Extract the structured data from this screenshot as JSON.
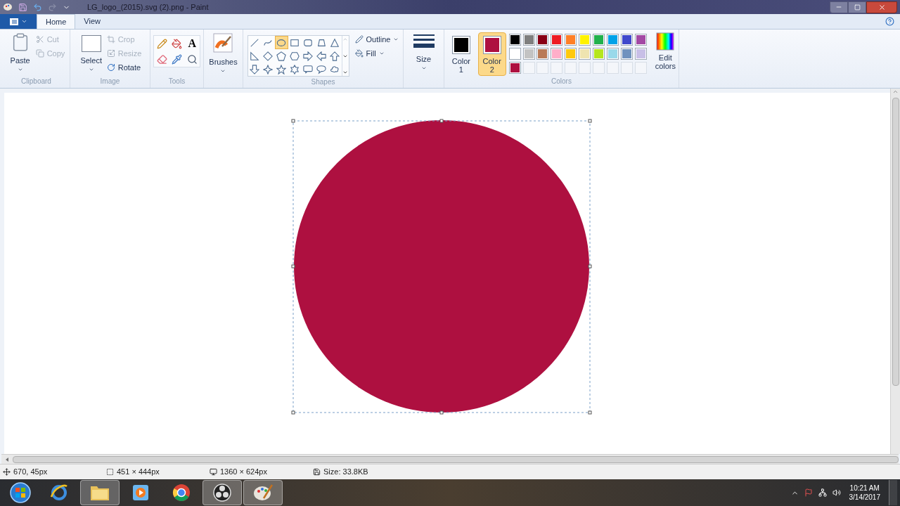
{
  "window": {
    "title": "LG_logo_(2015).svg (2).png - Paint"
  },
  "file_menu": {
    "open": false
  },
  "tabs": [
    {
      "label": "Home",
      "selected": true
    },
    {
      "label": "View",
      "selected": false
    }
  ],
  "clipboard": {
    "label": "Clipboard",
    "paste": "Paste",
    "cut": {
      "label": "Cut",
      "disabled": true
    },
    "copy": {
      "label": "Copy",
      "disabled": true
    }
  },
  "image": {
    "label": "Image",
    "select": "Select",
    "crop": {
      "label": "Crop",
      "disabled": true
    },
    "resize": {
      "label": "Resize",
      "disabled": true
    },
    "rotate": {
      "label": "Rotate",
      "disabled": false
    }
  },
  "tools": {
    "label": "Tools",
    "items": [
      {
        "kind": "pencil",
        "selected": false
      },
      {
        "kind": "fill",
        "selected": false
      },
      {
        "kind": "text",
        "label": "A",
        "selected": false
      },
      {
        "kind": "eraser",
        "selected": false
      },
      {
        "kind": "picker",
        "selected": false
      },
      {
        "kind": "magnifier",
        "selected": false
      }
    ]
  },
  "brushes": {
    "label": "Brushes"
  },
  "shapes": {
    "label": "Shapes",
    "outline": "Outline",
    "fill": "Fill",
    "items": [
      {
        "kind": "line",
        "selected": false
      },
      {
        "kind": "curve",
        "selected": false
      },
      {
        "kind": "oval",
        "selected": true
      },
      {
        "kind": "rectangle",
        "selected": false
      },
      {
        "kind": "rounded-rectangle",
        "selected": false
      },
      {
        "kind": "polygon",
        "selected": false
      },
      {
        "kind": "triangle",
        "selected": false
      },
      {
        "kind": "right-triangle",
        "selected": false
      },
      {
        "kind": "diamond",
        "selected": false
      },
      {
        "kind": "pentagon",
        "selected": false
      },
      {
        "kind": "hexagon",
        "selected": false
      },
      {
        "kind": "right-arrow",
        "selected": false
      },
      {
        "kind": "left-arrow",
        "selected": false
      },
      {
        "kind": "up-arrow",
        "selected": false
      },
      {
        "kind": "down-arrow",
        "selected": false
      },
      {
        "kind": "four-point-star",
        "selected": false
      },
      {
        "kind": "five-point-star",
        "selected": false
      },
      {
        "kind": "six-point-star",
        "selected": false
      },
      {
        "kind": "rounded-callout",
        "selected": false
      },
      {
        "kind": "oval-callout",
        "selected": false
      },
      {
        "kind": "cloud-callout",
        "selected": false
      }
    ]
  },
  "size": {
    "label": "Size"
  },
  "colors": {
    "label": "Colors",
    "color1": {
      "label": "Color",
      "number": "1",
      "color": "#000000",
      "selected": false
    },
    "color2": {
      "label": "Color",
      "number": "2",
      "color": "#ae1040",
      "selected": true
    },
    "edit": {
      "label": "Edit",
      "label2": "colors"
    },
    "palette": [
      {
        "color": "#000000"
      },
      {
        "color": "#7f7f7f"
      },
      {
        "color": "#880015"
      },
      {
        "color": "#ed1c24"
      },
      {
        "color": "#ff7f27"
      },
      {
        "color": "#fff200"
      },
      {
        "color": "#22b14c"
      },
      {
        "color": "#00a2e8"
      },
      {
        "color": "#3f48cc"
      },
      {
        "color": "#a349a4"
      },
      {
        "color": "#ffffff"
      },
      {
        "color": "#c3c3c3"
      },
      {
        "color": "#b97a57"
      },
      {
        "color": "#ffaec9"
      },
      {
        "color": "#ffc90e"
      },
      {
        "color": "#efe4b0"
      },
      {
        "color": "#b5e61d"
      },
      {
        "color": "#99d9ea"
      },
      {
        "color": "#7092be"
      },
      {
        "color": "#c8bfe7"
      },
      {
        "color": "#ae1040"
      },
      {
        "kind": "empty"
      },
      {
        "kind": "empty"
      },
      {
        "kind": "empty"
      },
      {
        "kind": "empty"
      },
      {
        "kind": "empty"
      },
      {
        "kind": "empty"
      },
      {
        "kind": "empty"
      },
      {
        "kind": "empty"
      },
      {
        "kind": "empty"
      }
    ]
  },
  "canvas": {
    "circle": {
      "color": "#ae1040"
    },
    "selection": true
  },
  "status_bar": [
    {
      "kind": "cursor",
      "text": "670, 45px"
    },
    {
      "kind": "selection",
      "text": "451 × 444px"
    },
    {
      "kind": "canvas",
      "text": "1360 × 624px"
    },
    {
      "kind": "file",
      "text": "Size: 33.8KB"
    }
  ],
  "taskbar": {
    "items": [
      {
        "kind": "start",
        "open": false
      },
      {
        "kind": "browser",
        "open": false
      },
      {
        "kind": "folder",
        "open": true
      },
      {
        "kind": "media",
        "open": false
      },
      {
        "kind": "web",
        "open": false
      },
      {
        "kind": "recorder",
        "open": true
      },
      {
        "kind": "paint",
        "open": true
      }
    ],
    "time": "10:21 AM",
    "date": "3/14/2017"
  }
}
